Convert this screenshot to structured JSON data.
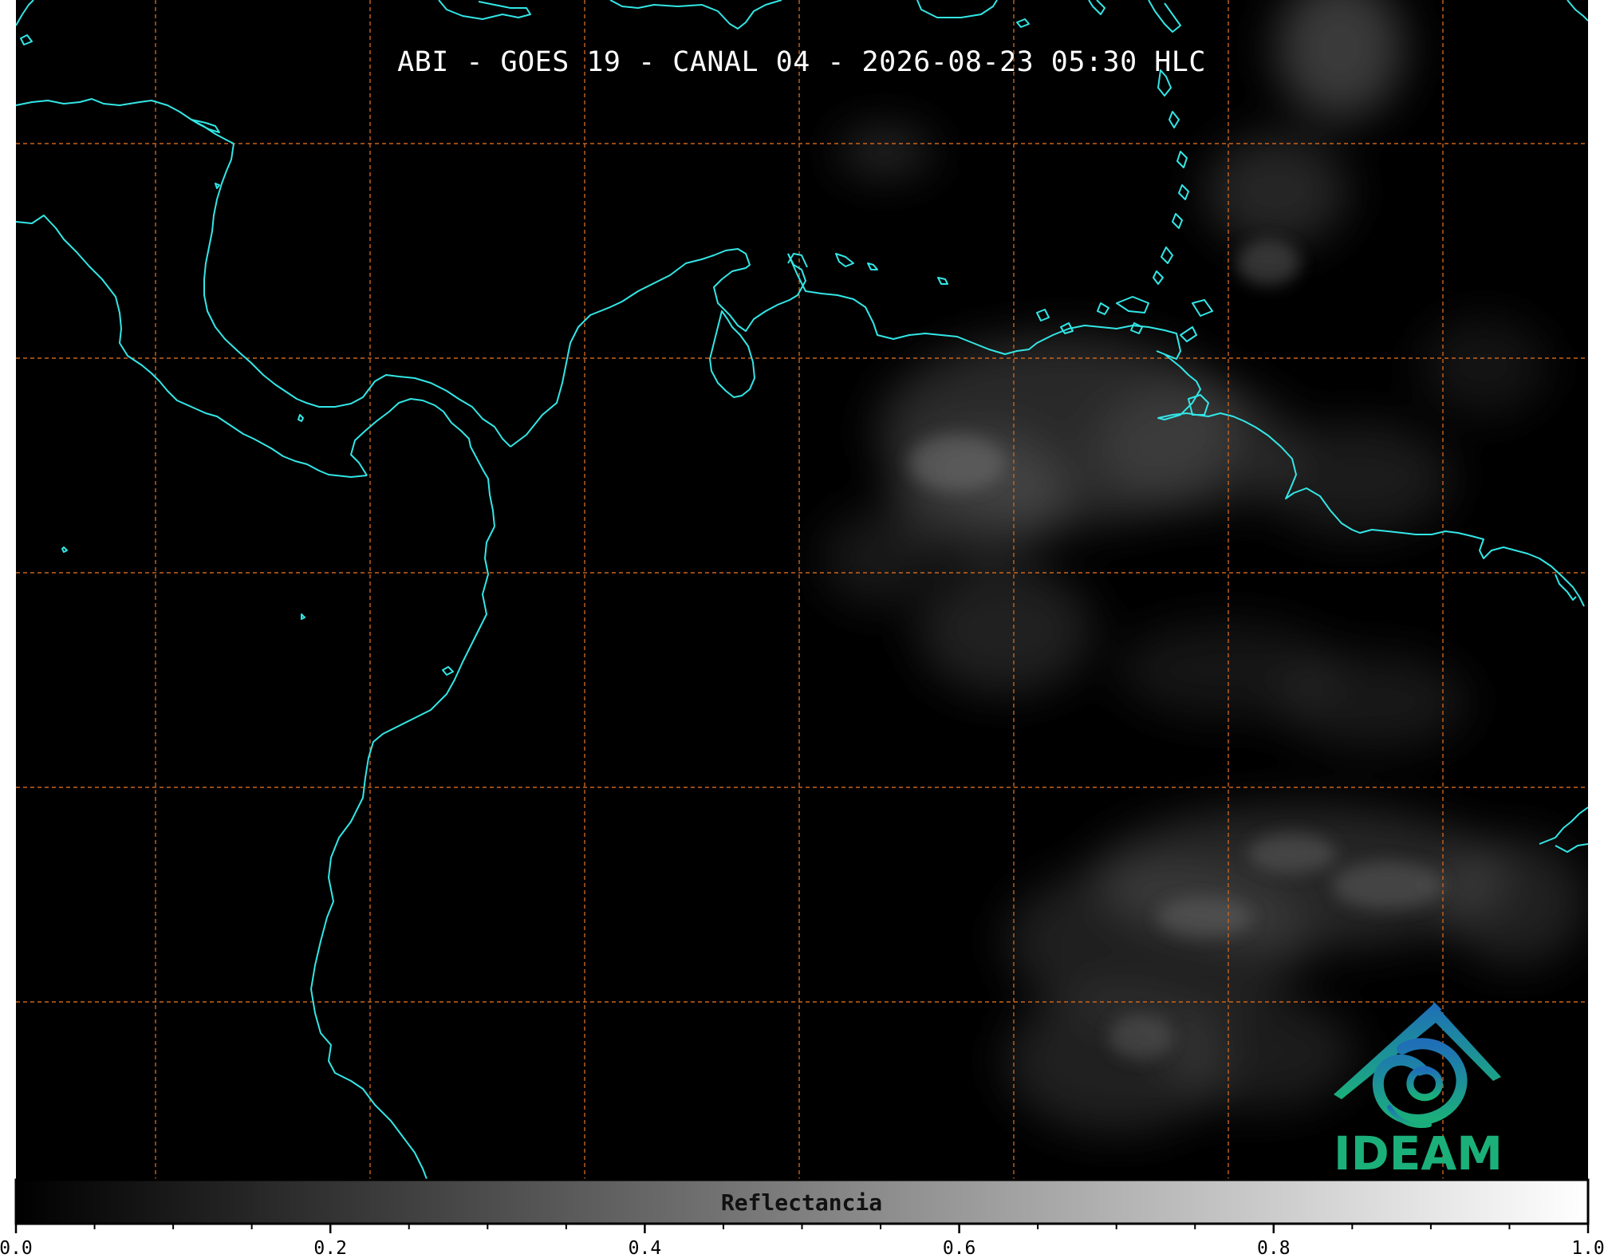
{
  "title": "ABI - GOES 19 - CANAL 04 - 2026-08-23 05:30 HLC",
  "colorbar": {
    "label": "Reflectancia",
    "min": 0.0,
    "max": 1.0,
    "tick_labels": [
      "0.0",
      "0.2",
      "0.4",
      "0.6",
      "0.8",
      "1.0"
    ],
    "tick_values": [
      0.0,
      0.2,
      0.4,
      0.6,
      0.8,
      1.0
    ],
    "minor_tick_step": 0.05
  },
  "logo": {
    "text": "IDEAM",
    "colors": [
      "#1f6fb8",
      "#1bb07a"
    ]
  },
  "colors": {
    "background": "#000000",
    "coastline": "#33e6e6",
    "gridlines": "#c8641e",
    "colormap_start": "#000000",
    "colormap_end": "#ffffff"
  },
  "map": {
    "gridlines": true,
    "gridline_style": "dashed"
  }
}
